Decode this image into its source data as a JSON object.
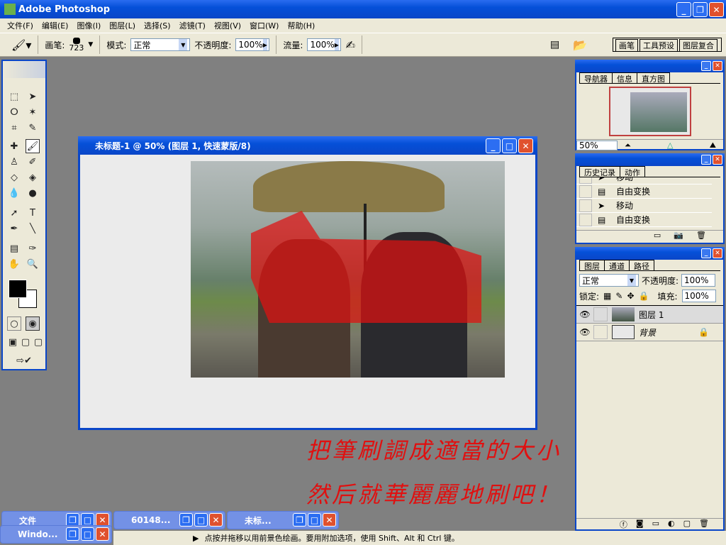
{
  "app": {
    "title": "Adobe Photoshop"
  },
  "menu": [
    "文件(F)",
    "编辑(E)",
    "图像(I)",
    "图层(L)",
    "选择(S)",
    "滤镜(T)",
    "视图(V)",
    "窗口(W)",
    "帮助(H)"
  ],
  "options": {
    "brush_label": "画笔:",
    "brush_size": "723",
    "mode_label": "模式:",
    "mode_value": "正常",
    "opacity_label": "不透明度:",
    "opacity_value": "100%",
    "flow_label": "流量:",
    "flow_value": "100%",
    "wells": [
      "画笔",
      "工具预设",
      "图层复合"
    ]
  },
  "document": {
    "title": "未标题-1 @ 50% (图层 1, 快速蒙版/8)",
    "mask_color": "#e01010"
  },
  "navigator": {
    "tabs": [
      "导航器",
      "信息",
      "直方图"
    ],
    "zoom": "50%"
  },
  "history": {
    "tabs": [
      "历史记录",
      "动作"
    ],
    "items": [
      "移动",
      "自由变换",
      "移动",
      "自由变换"
    ]
  },
  "layers": {
    "tabs": [
      "图层",
      "通道",
      "路径"
    ],
    "blend": "正常",
    "opacity_label": "不透明度:",
    "opacity": "100%",
    "lock_label": "锁定:",
    "fill_label": "填充:",
    "fill": "100%",
    "items": [
      {
        "name": "图层 1"
      },
      {
        "name": "背景"
      }
    ]
  },
  "minimized": [
    "文件",
    "60148...",
    "未标...",
    "Windo..."
  ],
  "status": "点按并拖移以用前景色绘画。要用附加选项，使用 Shift、Alt 和 Ctrl 键。",
  "annotation": [
    "把筆刷調成適當的大小",
    "然后就華麗麗地刷吧！"
  ]
}
